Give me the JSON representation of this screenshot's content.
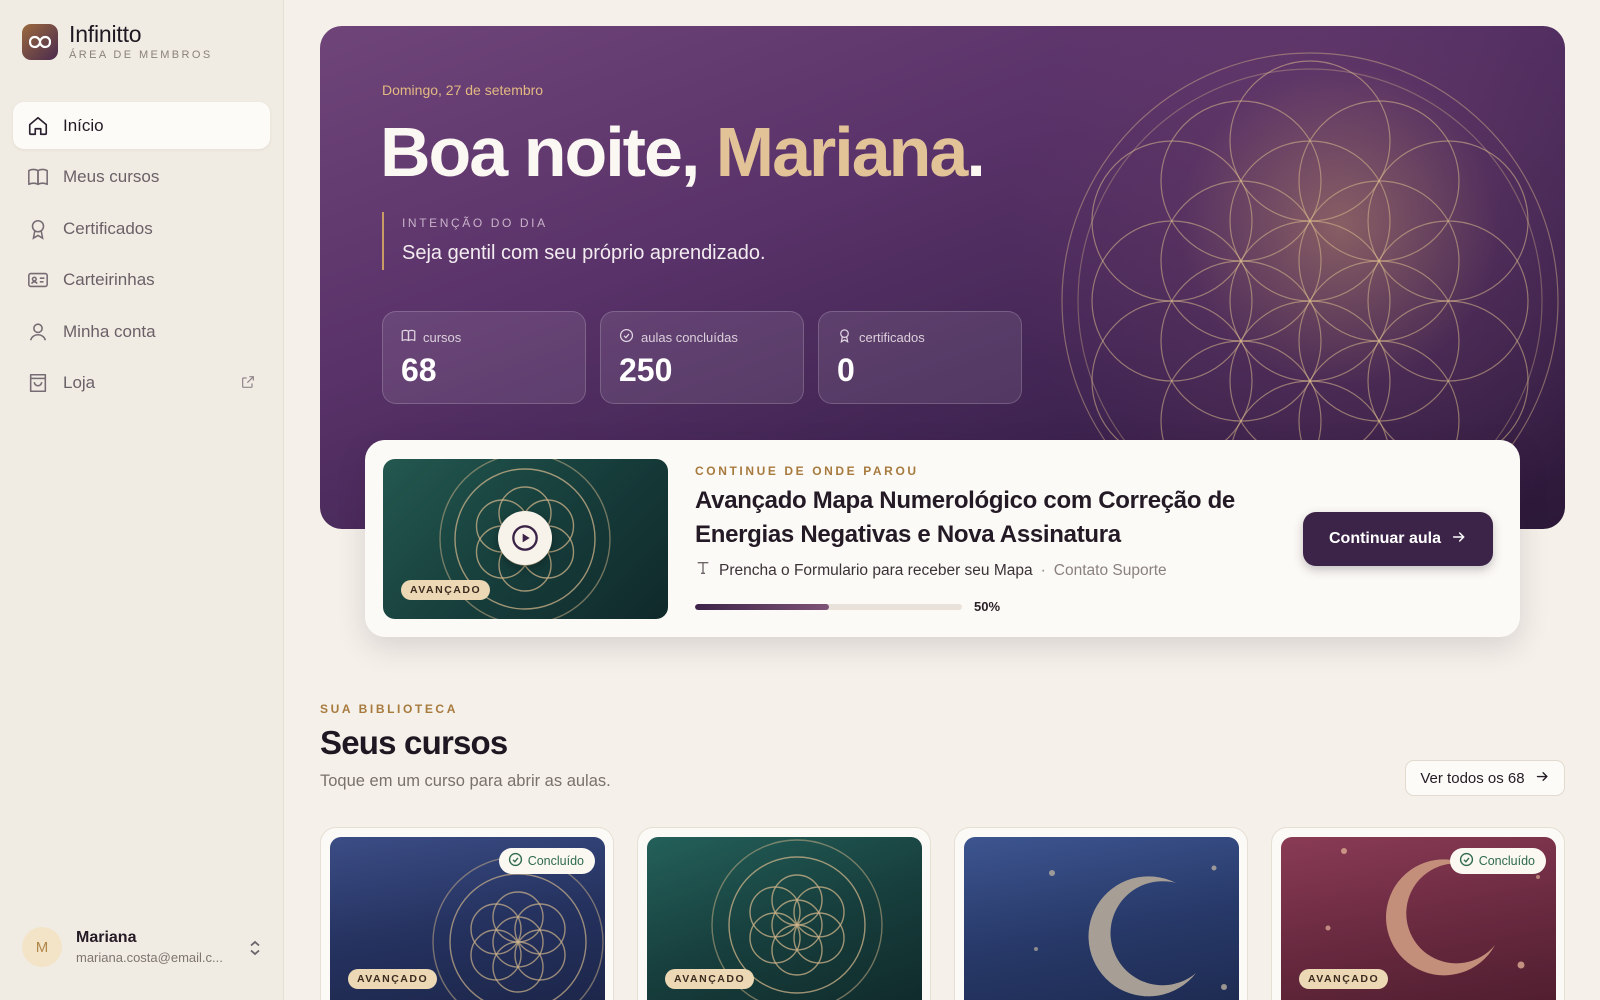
{
  "brand": {
    "name": "Infinitto",
    "subtitle": "ÁREA DE MEMBROS",
    "logo_icon": "infinity-icon"
  },
  "nav": [
    {
      "label": "Início",
      "icon": "home-icon",
      "active": true
    },
    {
      "label": "Meus cursos",
      "icon": "book-icon"
    },
    {
      "label": "Certificados",
      "icon": "award-icon"
    },
    {
      "label": "Carteirinhas",
      "icon": "id-card-icon"
    },
    {
      "label": "Minha conta",
      "icon": "user-icon"
    },
    {
      "label": "Loja",
      "icon": "shopping-bag-icon",
      "external_icon": "external-link-icon"
    }
  ],
  "user": {
    "initial": "M",
    "name": "Mariana",
    "email": "mariana.costa@email.c..."
  },
  "hero": {
    "date": "Domingo, 27 de setembro",
    "greeting": "Boa noite, ",
    "name": "Mariana",
    "punct": ".",
    "intent_label": "INTENÇÃO DO DIA",
    "intent_text": "Seja gentil com seu próprio aprendizado.",
    "stats": [
      {
        "label": "cursos",
        "value": "68",
        "icon": "book-icon"
      },
      {
        "label": "aulas concluídas",
        "value": "250",
        "icon": "check-circle-icon"
      },
      {
        "label": "certificados",
        "value": "0",
        "icon": "award-icon"
      }
    ]
  },
  "continue": {
    "eyebrow": "CONTINUE DE ONDE PAROU",
    "title": "Avançado Mapa Numerológico com Correção de Energias Negativas e Nova Assinatura",
    "lesson": "Prencha o Formulario para receber seu Mapa",
    "separator": "·",
    "module": "Contato Suporte",
    "progress": 50,
    "progress_text": "50%",
    "badge": "AVANÇADO",
    "button": "Continuar aula"
  },
  "library": {
    "eyebrow": "SUA BIBLIOTECA",
    "title": "Seus cursos",
    "subtitle": "Toque em um curso para abrir as aulas.",
    "see_all": "Ver todos os 68"
  },
  "courses": [
    {
      "badge": "AVANÇADO",
      "status": "Concluído",
      "theme": "navy-flower"
    },
    {
      "badge": "AVANÇADO",
      "status": "",
      "theme": "teal-flower"
    },
    {
      "badge": "",
      "status": "",
      "theme": "navy-moon"
    },
    {
      "badge": "AVANÇADO",
      "status": "Concluído",
      "theme": "wine-moon"
    }
  ],
  "colors": {
    "accent": "#3c2448",
    "gold": "#e2c398",
    "eyebrow": "#a77a3e",
    "success": "#2f6a4c",
    "background": "#f5f1ea"
  }
}
